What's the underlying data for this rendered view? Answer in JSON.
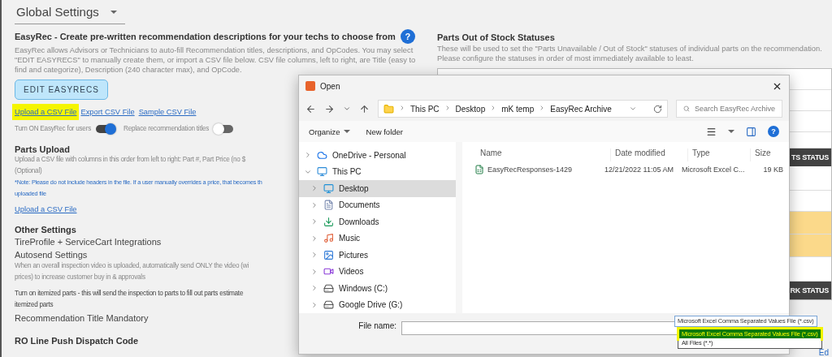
{
  "page_title": "Global Settings",
  "easyrec": {
    "heading": "EasyRec - Create pre-written recommendation descriptions for your techs to choose from",
    "help_label": "?",
    "description": "EasyRec allows Advisors or Technicians to auto-fill Recommendation titles, descriptions, and OpCodes. You may select \"EDIT EASYRECS\" to manually create them, or import a CSV file below. CSV file columns, left to right, are Title (easy to find and categorize), Description (240 character max), and OpCode.",
    "button": "EDIT EASYRECS",
    "links": [
      {
        "label": "Upload a CSV File",
        "highlighted": true
      },
      {
        "label": "Export CSV File",
        "highlighted": false
      },
      {
        "label": "Sample CSV File",
        "highlighted": false
      }
    ],
    "toggles": [
      {
        "label": "Turn ON EasyRec for users",
        "on": true
      },
      {
        "label": "Replace recommendation titles",
        "on": false
      }
    ]
  },
  "parts_upload": {
    "heading": "Parts Upload",
    "description_lines": [
      "Upload a CSV file with columns in this order from left to right: Part #, Part Price (no $",
      "(Optional)"
    ],
    "note_lines": [
      "*Note: Please do not include headers in the file. If a user manually overrides a price, that becomes th",
      "uploaded file"
    ],
    "link": "Upload a CSV File"
  },
  "other_settings": {
    "heading": "Other Settings",
    "items": [
      {
        "kind": "title",
        "lines": [
          "TireProfile + ServiceCart Integrations"
        ]
      },
      {
        "kind": "title",
        "lines": [
          "Autosend Settings"
        ]
      },
      {
        "kind": "hint",
        "lines": [
          "When an overall inspection video is uploaded, automatically send ONLY the video (wi",
          "prices) to increase customer buy in & approvals"
        ]
      },
      {
        "kind": "text",
        "lines": [
          "Turn on itemized parts - this will send the inspection to parts to fill out parts estimate",
          "itemized parts"
        ]
      },
      {
        "kind": "title",
        "lines": [
          "Recommendation Title Mandatory"
        ]
      },
      {
        "kind": "heading",
        "lines": [
          "RO Line Push Dispatch Code"
        ]
      }
    ]
  },
  "out_of_stock": {
    "heading": "Parts Out of Stock Statuses",
    "description": "These will be used to set the \"Parts Unavailable / Out of Stock\" statuses of individual parts on the recommendation. Please configure the statuses in order of most immediately available to least.",
    "status_bars": [
      "TS STATUS",
      "RK STATUS"
    ],
    "link": "Ed"
  },
  "dialog": {
    "title": "Open",
    "breadcrumb": [
      "This PC",
      "Desktop",
      "mK temp",
      "EasyRec Archive"
    ],
    "search_placeholder": "Search EasyRec Archive",
    "organize": "Organize",
    "new_folder": "New folder",
    "tree": [
      {
        "kind": "cloud",
        "label": "OneDrive - Personal",
        "expanded": false,
        "selected": false
      },
      {
        "kind": "pc",
        "label": "This PC",
        "expanded": true,
        "selected": false,
        "children": [
          {
            "kind": "desktop",
            "label": "Desktop",
            "expanded": false,
            "selected": true
          },
          {
            "kind": "documents",
            "label": "Documents",
            "expanded": false,
            "selected": false
          },
          {
            "kind": "downloads",
            "label": "Downloads",
            "expanded": false,
            "selected": false
          },
          {
            "kind": "music",
            "label": "Music",
            "expanded": false,
            "selected": false
          },
          {
            "kind": "pictures",
            "label": "Pictures",
            "expanded": false,
            "selected": false
          },
          {
            "kind": "videos",
            "label": "Videos",
            "expanded": false,
            "selected": false
          },
          {
            "kind": "drive",
            "label": "Windows (C:)",
            "expanded": false,
            "selected": false
          },
          {
            "kind": "drive",
            "label": "Google Drive (G:)",
            "expanded": false,
            "selected": false
          }
        ]
      }
    ],
    "columns": [
      "Name",
      "Date modified",
      "Type",
      "Size"
    ],
    "files": [
      {
        "name": "EasyRecResponses-1429",
        "date": "12/21/2022 11:05 AM",
        "type": "Microsoft Excel C...",
        "size": "19 KB"
      }
    ],
    "file_name_label": "File name:",
    "file_type": "Microsoft Excel Comma Separated Values File (*.csv)",
    "file_type_options": [
      {
        "label": "Microsoft Excel Comma Separated Values File (*.csv)",
        "selected": true,
        "highlighted": true
      },
      {
        "label": "All Files (*.*)",
        "selected": false,
        "highlighted": false
      }
    ]
  }
}
